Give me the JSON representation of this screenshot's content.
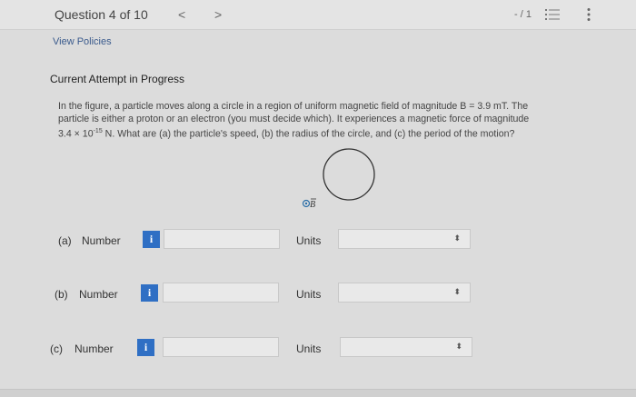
{
  "header": {
    "question_label": "Question 4 of 10",
    "prev_glyph": "<",
    "next_glyph": ">",
    "score": "- / 1"
  },
  "view_policies": "View Policies",
  "attempt_title": "Current Attempt in Progress",
  "problem": {
    "line1": "In the figure, a particle moves along a circle in a region of uniform magnetic field of magnitude B = 3.9 mT. The",
    "line2": "particle is either a proton or an electron (you must decide which). It experiences a magnetic force of magnitude",
    "line3_pre": "3.4 × 10",
    "line3_exp": "-15",
    "line3_post": " N. What are (a) the particle's speed, (b) the radius of the circle, and (c) the period of the motion?"
  },
  "figure": {
    "field_label": "B"
  },
  "parts": [
    {
      "label": "(a)",
      "field": "Number",
      "info": "i",
      "value": "",
      "units_label": "Units",
      "units_value": ""
    },
    {
      "label": "(b)",
      "field": "Number",
      "info": "i",
      "value": "",
      "units_label": "Units",
      "units_value": ""
    },
    {
      "label": "(c)",
      "field": "Number",
      "info": "i",
      "value": "",
      "units_label": "Units",
      "units_value": ""
    }
  ],
  "colors": {
    "info_button": "#2f6fc4",
    "link": "#3a5a8c"
  }
}
